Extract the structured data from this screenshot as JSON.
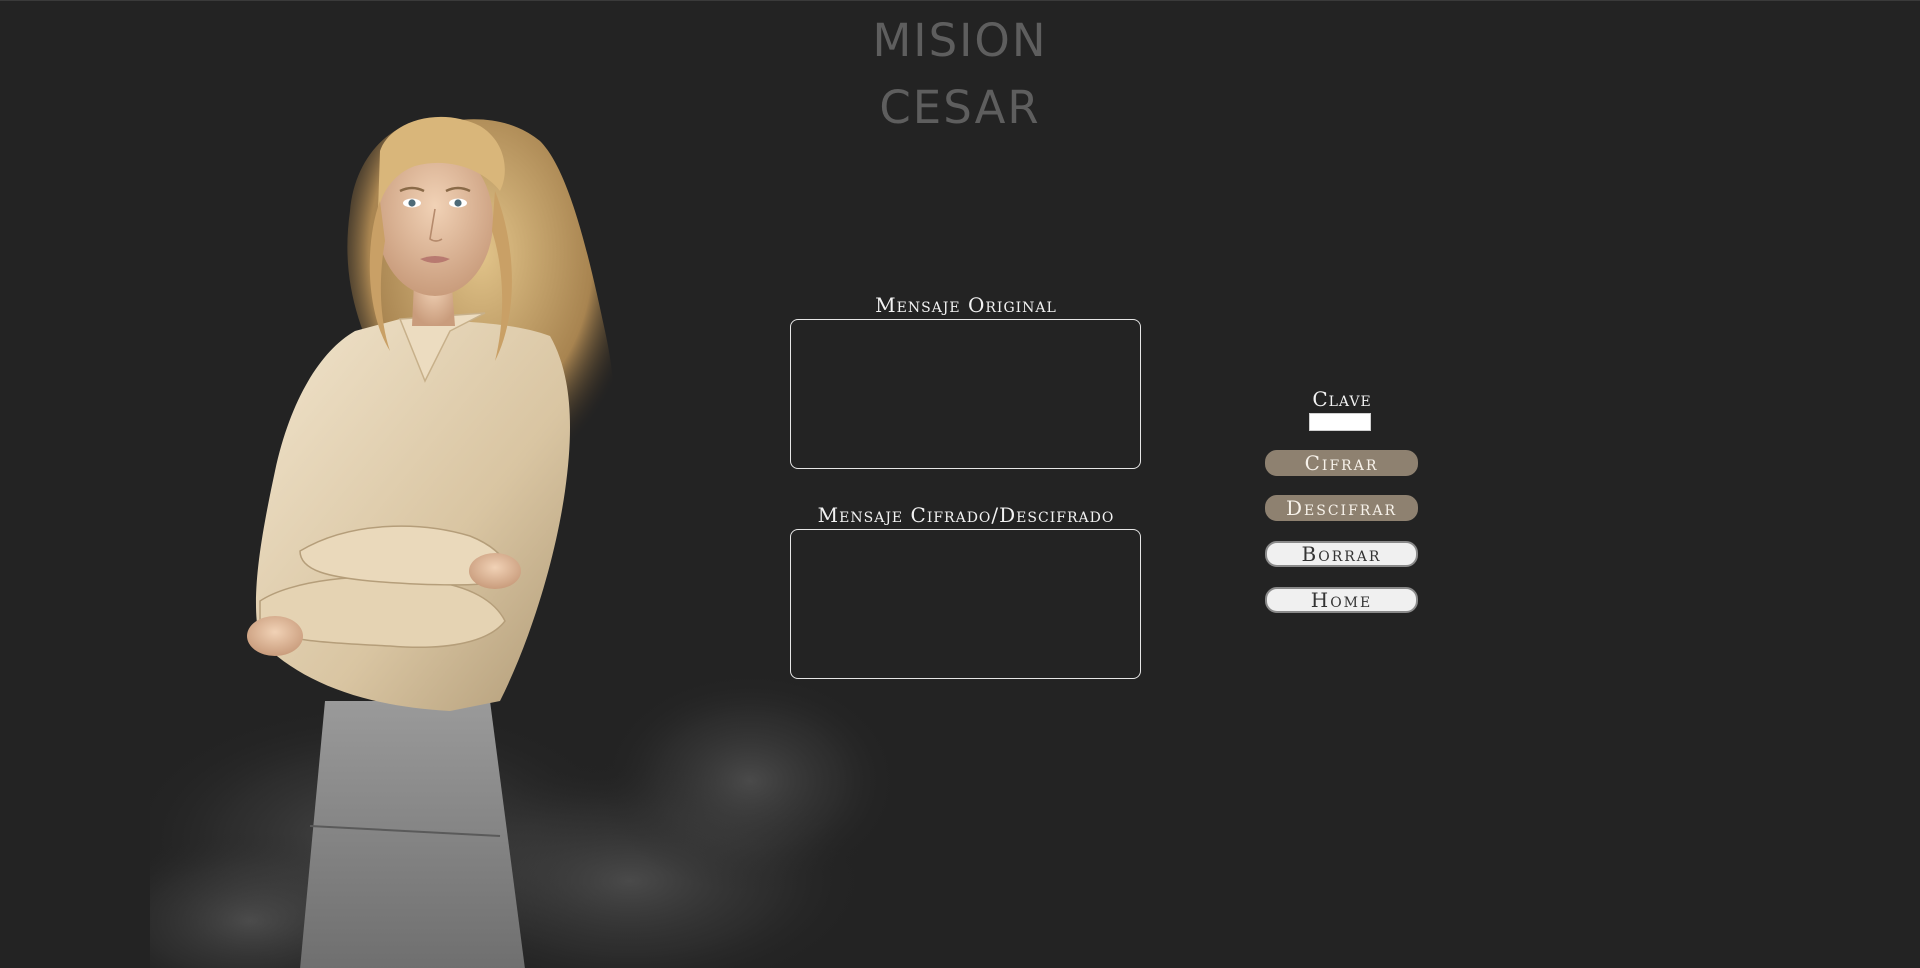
{
  "page": {
    "title_line1": "MISION",
    "title_line2": "CESAR",
    "background_color": "#232323",
    "title_color": "#5e5e5e"
  },
  "illustration": {
    "icon": "woman-portrait-smoke-image"
  },
  "original": {
    "label": "Mensaje Original",
    "value": "",
    "placeholder": ""
  },
  "result": {
    "label": "Mensaje Cifrado/Descifrado",
    "value": "",
    "placeholder": ""
  },
  "clave": {
    "label": "Clave",
    "value": ""
  },
  "buttons": {
    "cifrar": "Cifrar",
    "descifrar": "Descifrar",
    "borrar": "Borrar",
    "home": "Home",
    "accent_color": "#8e8170",
    "light_color": "#f0f0f0"
  }
}
